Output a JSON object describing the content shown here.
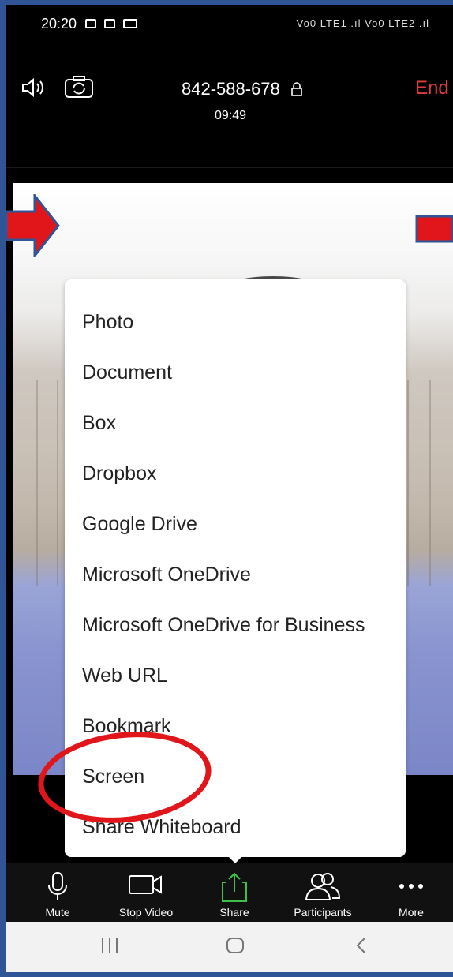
{
  "status_bar": {
    "time": "20:20",
    "right_text": "Vo0 LTE1 .ıl Vo0 LTE2 .ıl"
  },
  "meeting": {
    "meeting_id": "842-588-678",
    "timer": "09:49",
    "end_label": "End"
  },
  "share_menu": {
    "items": [
      "Photo",
      "Document",
      "Box",
      "Dropbox",
      "Google Drive",
      "Microsoft OneDrive",
      "Microsoft OneDrive for Business",
      "Web URL",
      "Bookmark",
      "Screen",
      "Share Whiteboard"
    ],
    "highlighted": "Screen"
  },
  "toolbar": {
    "mute": "Mute",
    "stop_video": "Stop Video",
    "share": "Share",
    "participants": "Participants",
    "more": "More"
  },
  "colors": {
    "end_red": "#e23a3a",
    "share_green": "#3cc04a",
    "annotation_red": "#e0161b",
    "frame_blue": "#2f5597"
  }
}
